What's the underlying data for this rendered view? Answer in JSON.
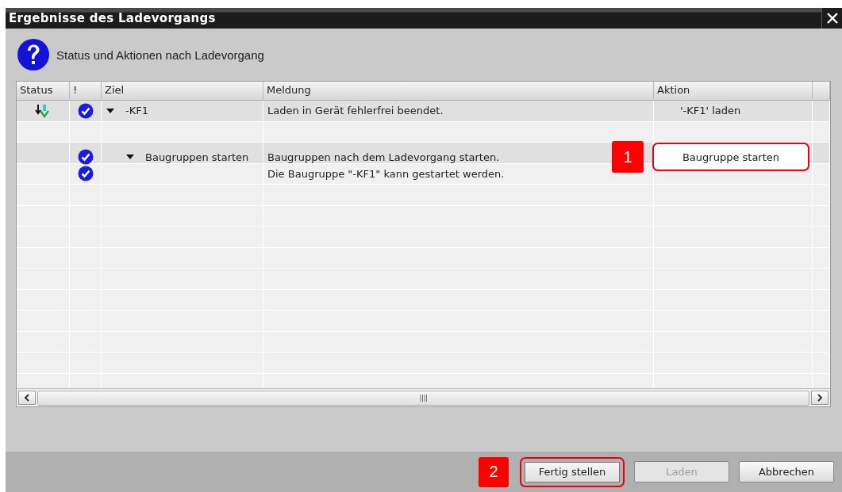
{
  "window": {
    "title": "Ergebnisse des Ladevorgangs"
  },
  "header": {
    "text": "Status und Aktionen nach Ladevorgang"
  },
  "table": {
    "columns": [
      "Status",
      "!",
      "Ziel",
      "Meldung",
      "Aktion"
    ],
    "rows": [
      {
        "kind": "download",
        "ok": true,
        "target": "-KF1",
        "expanded": true,
        "message": "Laden in Gerät fehlerfrei beendet.",
        "action": {
          "kind": "text",
          "label": "'-KF1' laden"
        },
        "children": [
          {
            "kind": "blank"
          },
          {
            "kind": "item",
            "ok": true,
            "target": "Baugruppen starten",
            "expanded": true,
            "message": "Baugruppen nach dem Ladevorgang starten.",
            "action": {
              "kind": "button",
              "label": "Baugruppe starten",
              "callout": "1"
            },
            "children": [
              {
                "kind": "item",
                "ok": true,
                "message": "Die Baugruppe \"-KF1\" kann gestartet werden."
              }
            ]
          }
        ]
      }
    ]
  },
  "buttons": [
    {
      "label": "Fertig stellen",
      "disabled": false,
      "callout": "2"
    },
    {
      "label": "Laden",
      "disabled": true
    },
    {
      "label": "Abbrechen",
      "disabled": false
    }
  ]
}
